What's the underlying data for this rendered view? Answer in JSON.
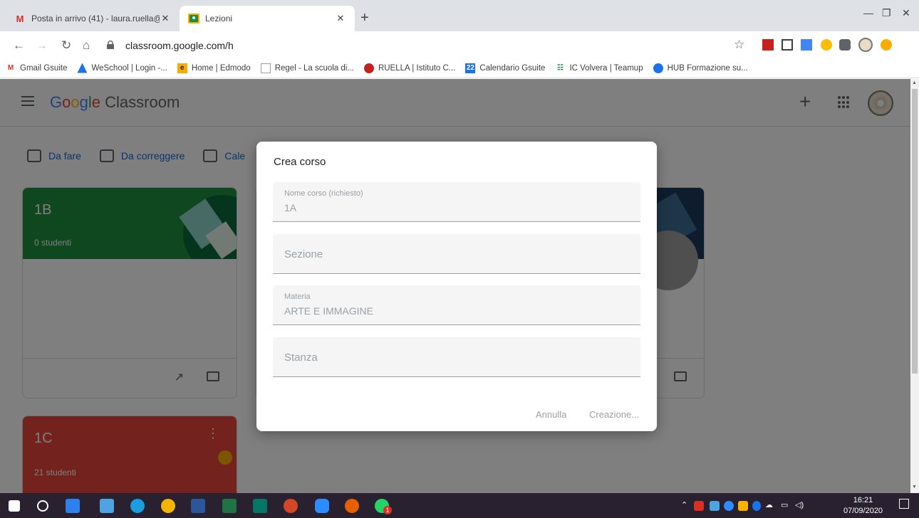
{
  "browser": {
    "tabs": [
      {
        "title": "Posta in arrivo (41) - laura.ruella@",
        "icon": "gmail-icon"
      },
      {
        "title": "Lezioni",
        "icon": "classroom-icon"
      }
    ],
    "url": "classroom.google.com/h",
    "bookmarks": [
      {
        "label": "Gmail Gsuite",
        "icon": "gmail-icon",
        "color": "#d93025"
      },
      {
        "label": "WeSchool | Login -...",
        "icon": "weschool-icon",
        "color": "#1a73e8"
      },
      {
        "label": "Home | Edmodo",
        "icon": "edmodo-icon",
        "color": "#f9ab00"
      },
      {
        "label": "Regel - La scuola di...",
        "icon": "page-icon",
        "color": "#9aa0a6"
      },
      {
        "label": "RUELLA | Istituto C...",
        "icon": "school-icon",
        "color": "#c5221f"
      },
      {
        "label": "Calendario Gsuite",
        "icon": "calendar-icon",
        "color": "#1a73e8"
      },
      {
        "label": "IC Volvera | Teamup",
        "icon": "teamup-icon",
        "color": "#188038"
      },
      {
        "label": "HUB Formazione su...",
        "icon": "hub-icon",
        "color": "#1a73e8"
      }
    ]
  },
  "app": {
    "brand_google": "Google",
    "brand_product": "Classroom",
    "plus_label": "+",
    "subnav": [
      {
        "label": "Da fare",
        "icon": "todo-icon"
      },
      {
        "label": "Da correggere",
        "icon": "review-icon"
      },
      {
        "label": "Cale",
        "icon": "calendar-icon"
      }
    ],
    "cards": [
      {
        "name": "1B",
        "students": "0 studenti",
        "color": "#1e8e3e"
      },
      {
        "name": "1C",
        "students": "21 studenti",
        "color": "#e8453c"
      }
    ]
  },
  "dialog": {
    "title": "Crea corso",
    "fields": [
      {
        "label": "Nome corso (richiesto)",
        "value": "1A"
      },
      {
        "label": "",
        "placeholder": "Sezione"
      },
      {
        "label": "Materia",
        "value": "ARTE E IMMAGINE"
      },
      {
        "label": "",
        "placeholder": "Stanza"
      }
    ],
    "cancel": "Annulla",
    "create": "Creazione..."
  },
  "taskbar": {
    "time": "16:21",
    "date": "07/09/2020",
    "whatsapp_badge": "1"
  }
}
